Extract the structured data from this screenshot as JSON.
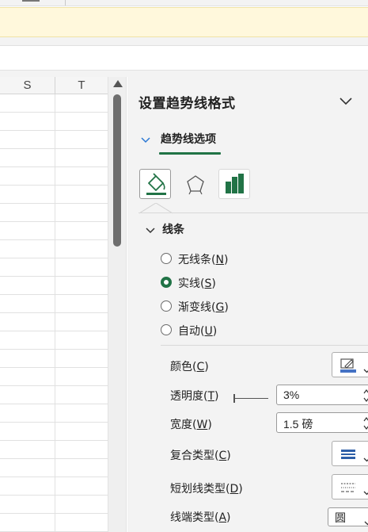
{
  "ribbon": {
    "message_bar": ""
  },
  "grid": {
    "columns": [
      "S",
      "T"
    ]
  },
  "pane": {
    "title": "设置趋势线格式",
    "tab_label": "趋势线选项",
    "category_icons": [
      "paint-bucket-icon",
      "pentagon-effects-icon",
      "bar-chart-icon"
    ],
    "section": {
      "label": "线条",
      "options": [
        {
          "label": "无线条",
          "key": "N",
          "checked": false
        },
        {
          "label": "实线",
          "key": "S",
          "checked": true
        },
        {
          "label": "渐变线",
          "key": "G",
          "checked": false
        },
        {
          "label": "自动",
          "key": "U",
          "checked": false
        }
      ]
    },
    "properties": {
      "color": {
        "label": "颜色",
        "key": "C",
        "icon": "pen-color-icon",
        "swatch": "#4472c4"
      },
      "transparency": {
        "label": "透明度",
        "key": "T",
        "value": "3%"
      },
      "width": {
        "label": "宽度",
        "key": "W",
        "value": "1.5 磅"
      },
      "compound_type": {
        "label": "复合类型",
        "key": "C",
        "icon": "compound-lines-icon"
      },
      "dash_type": {
        "label": "短划线类型",
        "key": "D",
        "icon": "dash-lines-icon"
      },
      "cap_type": {
        "label": "线端类型",
        "key": "A",
        "value": "圆"
      }
    }
  },
  "colors": {
    "accent": "#217346",
    "pane_bg": "#f3f3f3",
    "message_bar_bg": "#fff8dc"
  }
}
